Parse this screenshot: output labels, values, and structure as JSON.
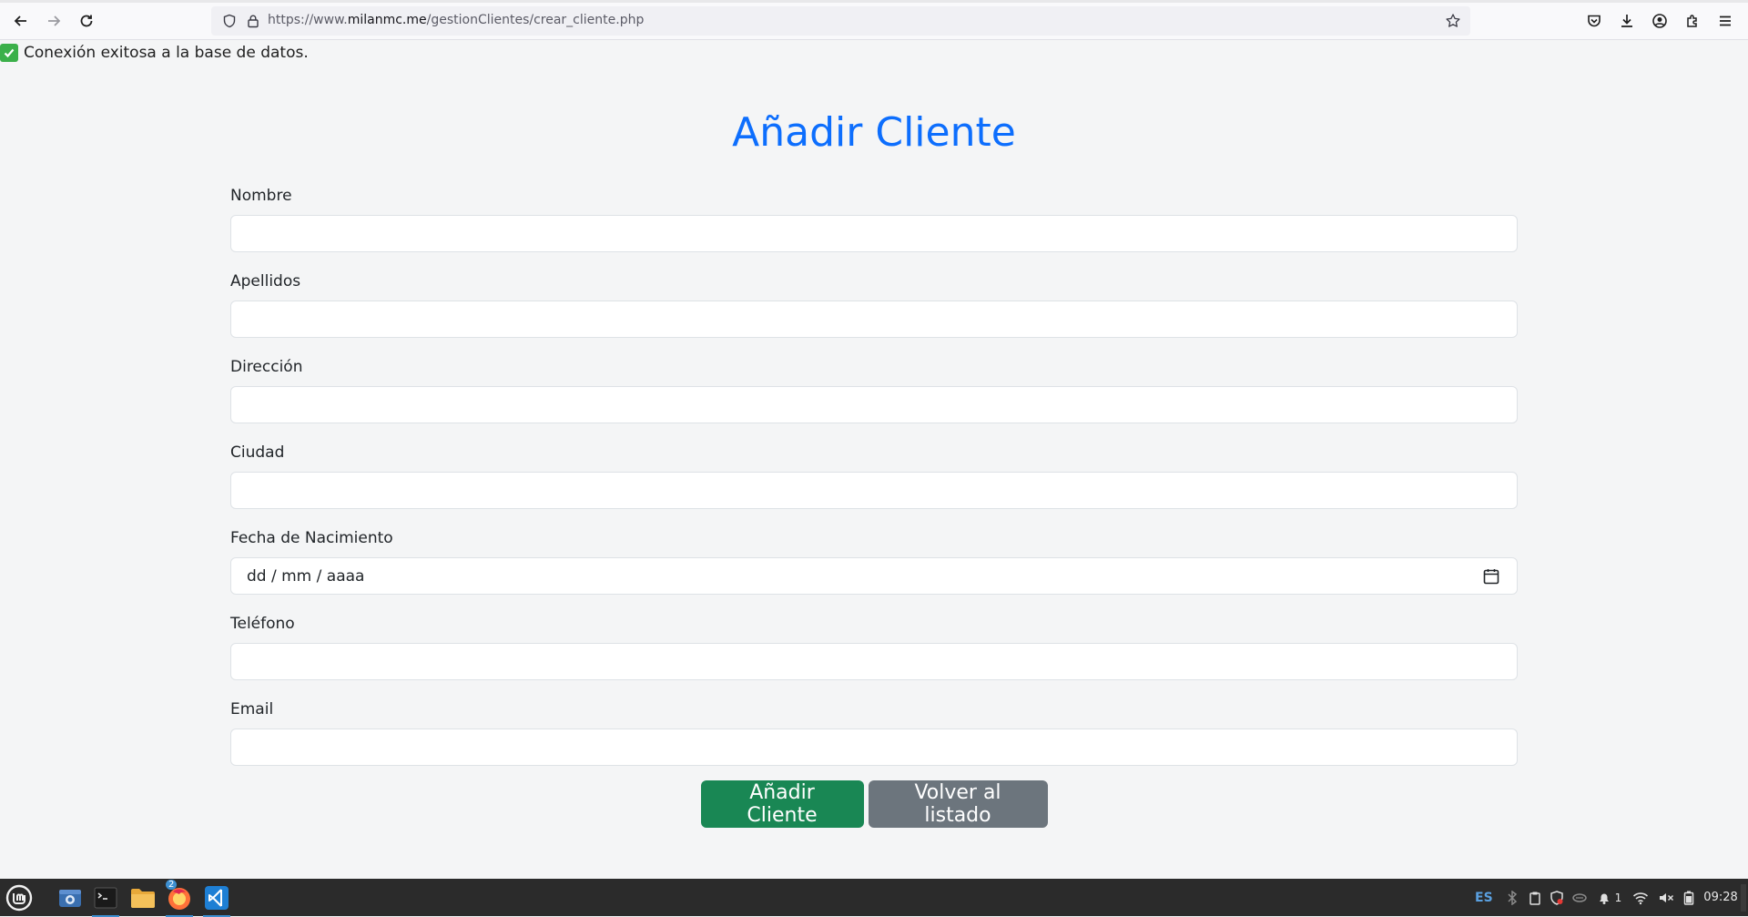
{
  "browser": {
    "url_prefix": "https://www.",
    "url_host": "milanmc.me",
    "url_path": "/gestionClientes/crear_cliente.php"
  },
  "status": {
    "message": "Conexión exitosa a la base de datos."
  },
  "page": {
    "title": "Añadir Cliente"
  },
  "form": {
    "fields": [
      {
        "label": "Nombre",
        "value": ""
      },
      {
        "label": "Apellidos",
        "value": ""
      },
      {
        "label": "Dirección",
        "value": ""
      },
      {
        "label": "Ciudad",
        "value": ""
      },
      {
        "label": "Fecha de Nacimiento",
        "placeholder": "dd / mm / aaaa"
      },
      {
        "label": "Teléfono",
        "value": ""
      },
      {
        "label": "Email",
        "value": ""
      }
    ],
    "submit_label": "Añadir Cliente",
    "back_label": "Volver al listado"
  },
  "taskbar": {
    "firefox_badge": "2",
    "language": "ES",
    "notification_count": "1",
    "clock": "09:28"
  },
  "colors": {
    "title": "#0d6efd",
    "submit": "#198754",
    "back": "#6c757d",
    "success": "#3bb04a"
  }
}
